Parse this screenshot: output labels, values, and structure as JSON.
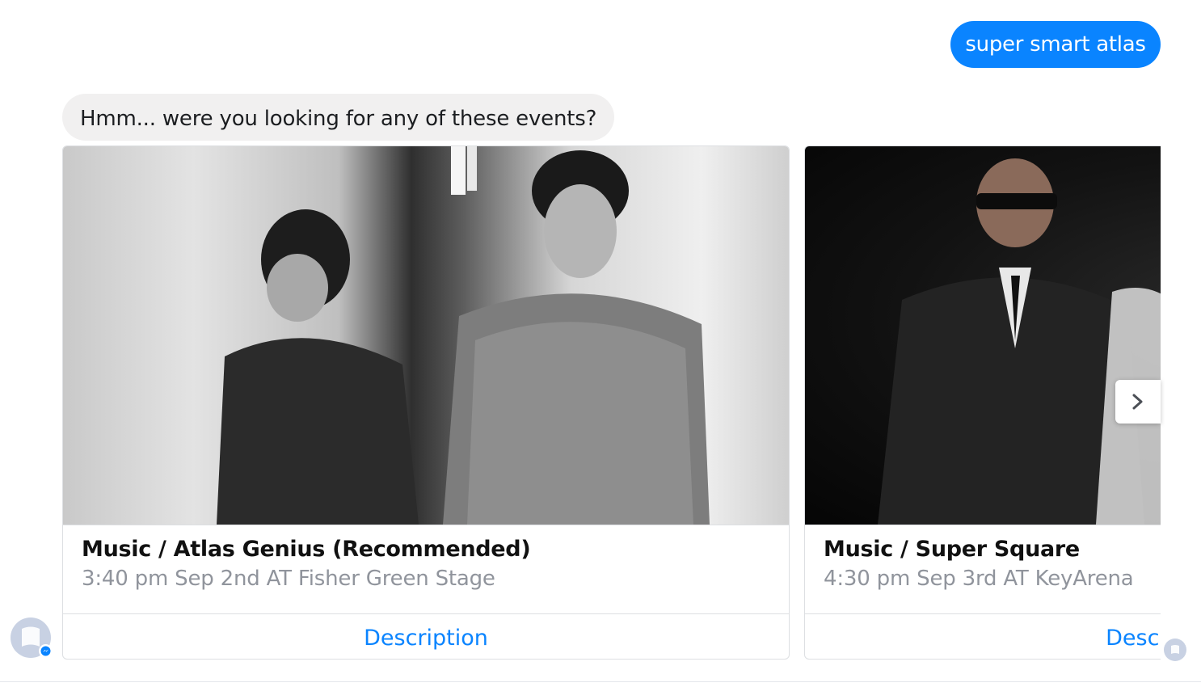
{
  "messages": {
    "user_text": "super smart atlas",
    "bot_text": "Hmm... were you looking for any of these events?"
  },
  "cards": [
    {
      "title": "Music / Atlas Genius (Recommended)",
      "subtitle": "3:40 pm Sep 2nd AT Fisher Green Stage",
      "button": "Description"
    },
    {
      "title": "Music / Super Square",
      "subtitle": "4:30 pm Sep 3rd AT KeyArena",
      "button": "Description"
    }
  ],
  "icons": {
    "next": "chevron-right-icon",
    "avatar": "bot-avatar-icon",
    "badge": "messenger-badge-icon",
    "read_receipt": "read-receipt-icon"
  },
  "colors": {
    "accent": "#0a84ff",
    "bot_bubble": "#f1f0f0",
    "subtitle": "#90949c"
  }
}
